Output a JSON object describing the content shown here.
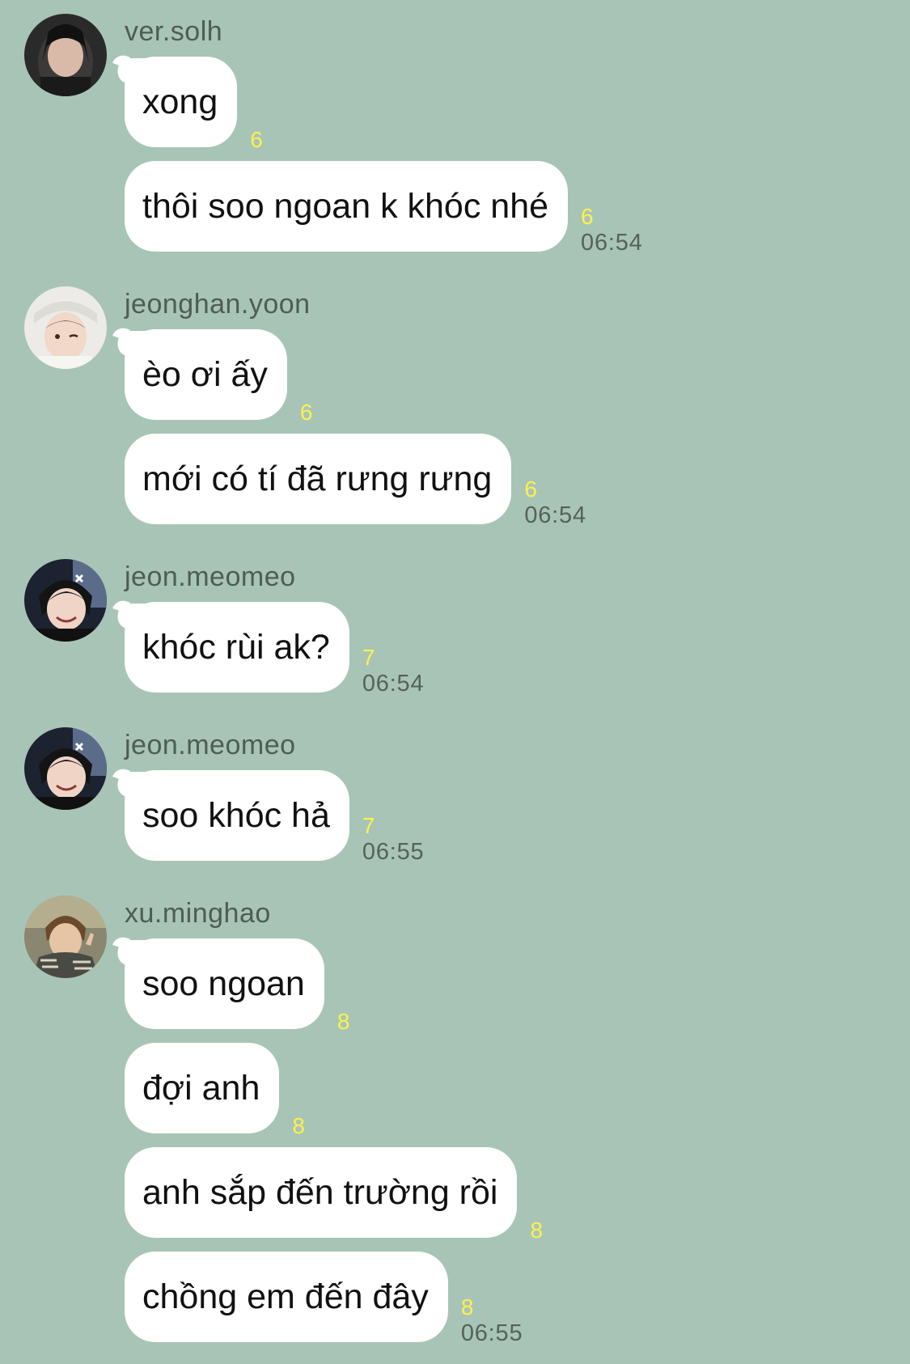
{
  "colors": {
    "background": "#a8c4b7",
    "bubble": "#ffffff",
    "read_count": "#fff04d",
    "timestamp": "#55615b",
    "sender_name": "#4e5c55"
  },
  "groups": [
    {
      "sender": "ver.solh",
      "avatar": "avatar-ver-solh",
      "messages": [
        {
          "text": "xong",
          "read": "6",
          "time": ""
        },
        {
          "text": "thôi soo ngoan k khóc nhé",
          "read": "6",
          "time": "06:54"
        }
      ]
    },
    {
      "sender": "jeonghan.yoon",
      "avatar": "avatar-jeonghan-yoon",
      "messages": [
        {
          "text": "èo ơi ấy",
          "read": "6",
          "time": ""
        },
        {
          "text": "mới có tí đã rưng rưng",
          "read": "6",
          "time": "06:54"
        }
      ]
    },
    {
      "sender": "jeon.meomeo",
      "avatar": "avatar-jeon-meomeo",
      "messages": [
        {
          "text": "khóc rùi ak?",
          "read": "7",
          "time": "06:54"
        }
      ]
    },
    {
      "sender": "jeon.meomeo",
      "avatar": "avatar-jeon-meomeo",
      "messages": [
        {
          "text": "soo khóc hả",
          "read": "7",
          "time": "06:55"
        }
      ]
    },
    {
      "sender": "xu.minghao",
      "avatar": "avatar-xu-minghao",
      "messages": [
        {
          "text": "soo ngoan",
          "read": "8",
          "time": ""
        },
        {
          "text": "đợi anh",
          "read": "8",
          "time": ""
        },
        {
          "text": "anh sắp đến trường rồi",
          "read": "8",
          "time": ""
        },
        {
          "text": "chồng em đến đây",
          "read": "8",
          "time": "06:55"
        }
      ]
    }
  ]
}
